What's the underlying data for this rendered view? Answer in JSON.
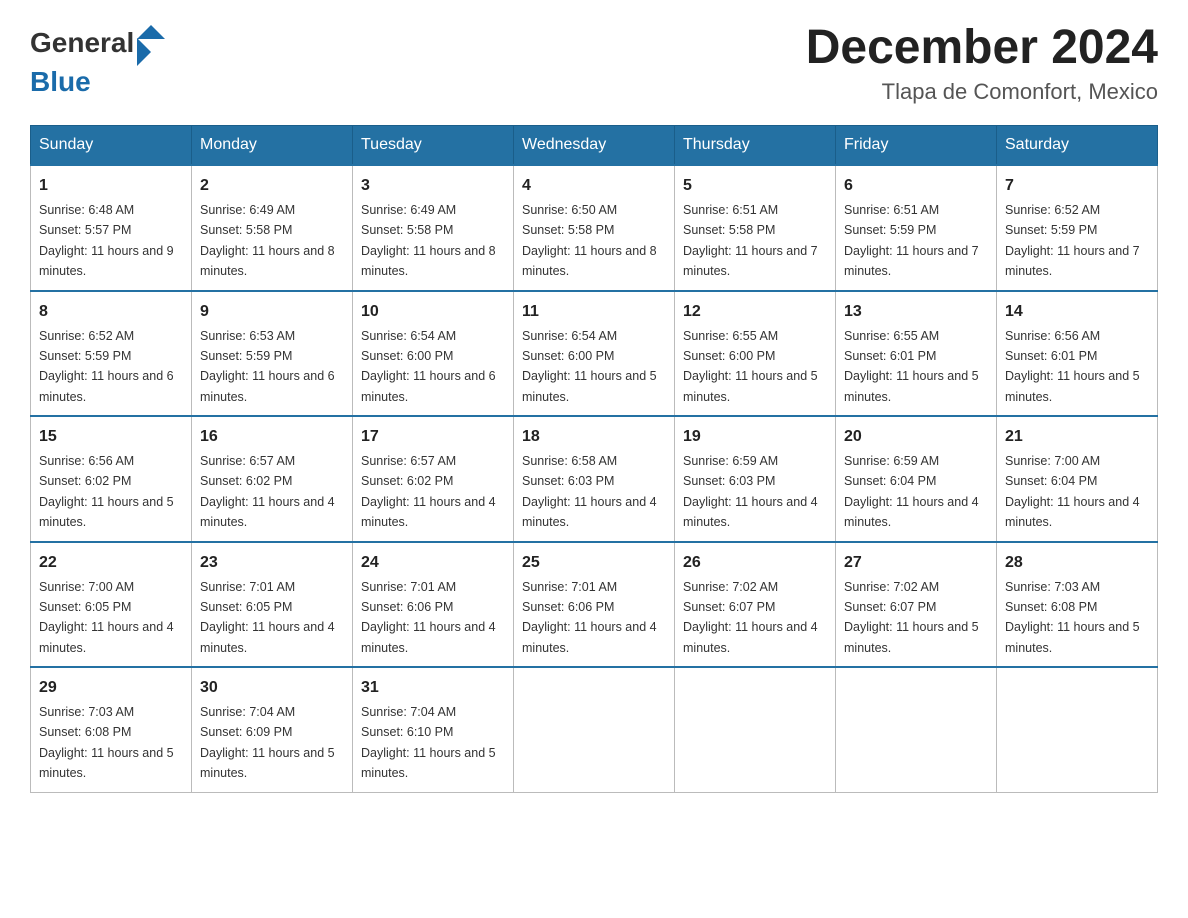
{
  "logo": {
    "general": "General",
    "blue": "Blue"
  },
  "title": "December 2024",
  "subtitle": "Tlapa de Comonfort, Mexico",
  "days_of_week": [
    "Sunday",
    "Monday",
    "Tuesday",
    "Wednesday",
    "Thursday",
    "Friday",
    "Saturday"
  ],
  "weeks": [
    [
      {
        "num": "1",
        "sunrise": "6:48 AM",
        "sunset": "5:57 PM",
        "daylight": "11 hours and 9 minutes."
      },
      {
        "num": "2",
        "sunrise": "6:49 AM",
        "sunset": "5:58 PM",
        "daylight": "11 hours and 8 minutes."
      },
      {
        "num": "3",
        "sunrise": "6:49 AM",
        "sunset": "5:58 PM",
        "daylight": "11 hours and 8 minutes."
      },
      {
        "num": "4",
        "sunrise": "6:50 AM",
        "sunset": "5:58 PM",
        "daylight": "11 hours and 8 minutes."
      },
      {
        "num": "5",
        "sunrise": "6:51 AM",
        "sunset": "5:58 PM",
        "daylight": "11 hours and 7 minutes."
      },
      {
        "num": "6",
        "sunrise": "6:51 AM",
        "sunset": "5:59 PM",
        "daylight": "11 hours and 7 minutes."
      },
      {
        "num": "7",
        "sunrise": "6:52 AM",
        "sunset": "5:59 PM",
        "daylight": "11 hours and 7 minutes."
      }
    ],
    [
      {
        "num": "8",
        "sunrise": "6:52 AM",
        "sunset": "5:59 PM",
        "daylight": "11 hours and 6 minutes."
      },
      {
        "num": "9",
        "sunrise": "6:53 AM",
        "sunset": "5:59 PM",
        "daylight": "11 hours and 6 minutes."
      },
      {
        "num": "10",
        "sunrise": "6:54 AM",
        "sunset": "6:00 PM",
        "daylight": "11 hours and 6 minutes."
      },
      {
        "num": "11",
        "sunrise": "6:54 AM",
        "sunset": "6:00 PM",
        "daylight": "11 hours and 5 minutes."
      },
      {
        "num": "12",
        "sunrise": "6:55 AM",
        "sunset": "6:00 PM",
        "daylight": "11 hours and 5 minutes."
      },
      {
        "num": "13",
        "sunrise": "6:55 AM",
        "sunset": "6:01 PM",
        "daylight": "11 hours and 5 minutes."
      },
      {
        "num": "14",
        "sunrise": "6:56 AM",
        "sunset": "6:01 PM",
        "daylight": "11 hours and 5 minutes."
      }
    ],
    [
      {
        "num": "15",
        "sunrise": "6:56 AM",
        "sunset": "6:02 PM",
        "daylight": "11 hours and 5 minutes."
      },
      {
        "num": "16",
        "sunrise": "6:57 AM",
        "sunset": "6:02 PM",
        "daylight": "11 hours and 4 minutes."
      },
      {
        "num": "17",
        "sunrise": "6:57 AM",
        "sunset": "6:02 PM",
        "daylight": "11 hours and 4 minutes."
      },
      {
        "num": "18",
        "sunrise": "6:58 AM",
        "sunset": "6:03 PM",
        "daylight": "11 hours and 4 minutes."
      },
      {
        "num": "19",
        "sunrise": "6:59 AM",
        "sunset": "6:03 PM",
        "daylight": "11 hours and 4 minutes."
      },
      {
        "num": "20",
        "sunrise": "6:59 AM",
        "sunset": "6:04 PM",
        "daylight": "11 hours and 4 minutes."
      },
      {
        "num": "21",
        "sunrise": "7:00 AM",
        "sunset": "6:04 PM",
        "daylight": "11 hours and 4 minutes."
      }
    ],
    [
      {
        "num": "22",
        "sunrise": "7:00 AM",
        "sunset": "6:05 PM",
        "daylight": "11 hours and 4 minutes."
      },
      {
        "num": "23",
        "sunrise": "7:01 AM",
        "sunset": "6:05 PM",
        "daylight": "11 hours and 4 minutes."
      },
      {
        "num": "24",
        "sunrise": "7:01 AM",
        "sunset": "6:06 PM",
        "daylight": "11 hours and 4 minutes."
      },
      {
        "num": "25",
        "sunrise": "7:01 AM",
        "sunset": "6:06 PM",
        "daylight": "11 hours and 4 minutes."
      },
      {
        "num": "26",
        "sunrise": "7:02 AM",
        "sunset": "6:07 PM",
        "daylight": "11 hours and 4 minutes."
      },
      {
        "num": "27",
        "sunrise": "7:02 AM",
        "sunset": "6:07 PM",
        "daylight": "11 hours and 5 minutes."
      },
      {
        "num": "28",
        "sunrise": "7:03 AM",
        "sunset": "6:08 PM",
        "daylight": "11 hours and 5 minutes."
      }
    ],
    [
      {
        "num": "29",
        "sunrise": "7:03 AM",
        "sunset": "6:08 PM",
        "daylight": "11 hours and 5 minutes."
      },
      {
        "num": "30",
        "sunrise": "7:04 AM",
        "sunset": "6:09 PM",
        "daylight": "11 hours and 5 minutes."
      },
      {
        "num": "31",
        "sunrise": "7:04 AM",
        "sunset": "6:10 PM",
        "daylight": "11 hours and 5 minutes."
      },
      null,
      null,
      null,
      null
    ]
  ]
}
